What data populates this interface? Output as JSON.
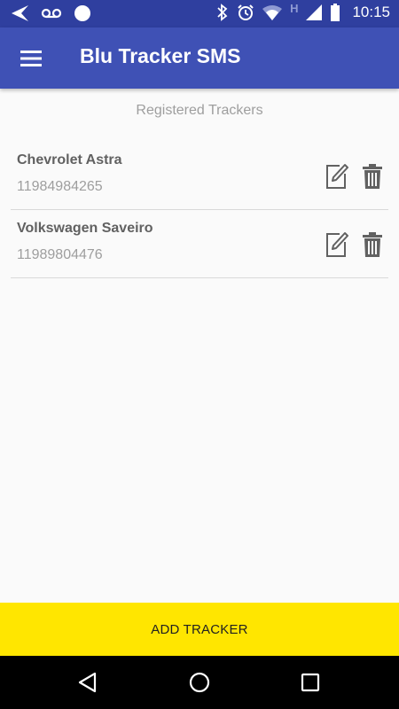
{
  "status_bar": {
    "time": "10:15",
    "icons_left": [
      "back-arrow-icon",
      "voicemail-icon",
      "circle-icon"
    ],
    "icons_right": [
      "bluetooth-icon",
      "alarm-icon",
      "wifi-icon",
      "h-network-icon",
      "signal-icon",
      "battery-icon"
    ],
    "network_label": "H"
  },
  "app_bar": {
    "title": "Blu Tracker SMS",
    "color": "#3f51b5"
  },
  "main": {
    "section_title": "Registered Trackers",
    "trackers": [
      {
        "name": "Chevrolet Astra",
        "phone": "11984984265"
      },
      {
        "name": "Volkswagen Saveiro",
        "phone": "11989804476"
      }
    ]
  },
  "bottom": {
    "add_label": "ADD TRACKER",
    "color": "#ffe600"
  },
  "nav_bar": {
    "buttons": [
      "back-icon",
      "home-icon",
      "recents-icon"
    ]
  }
}
